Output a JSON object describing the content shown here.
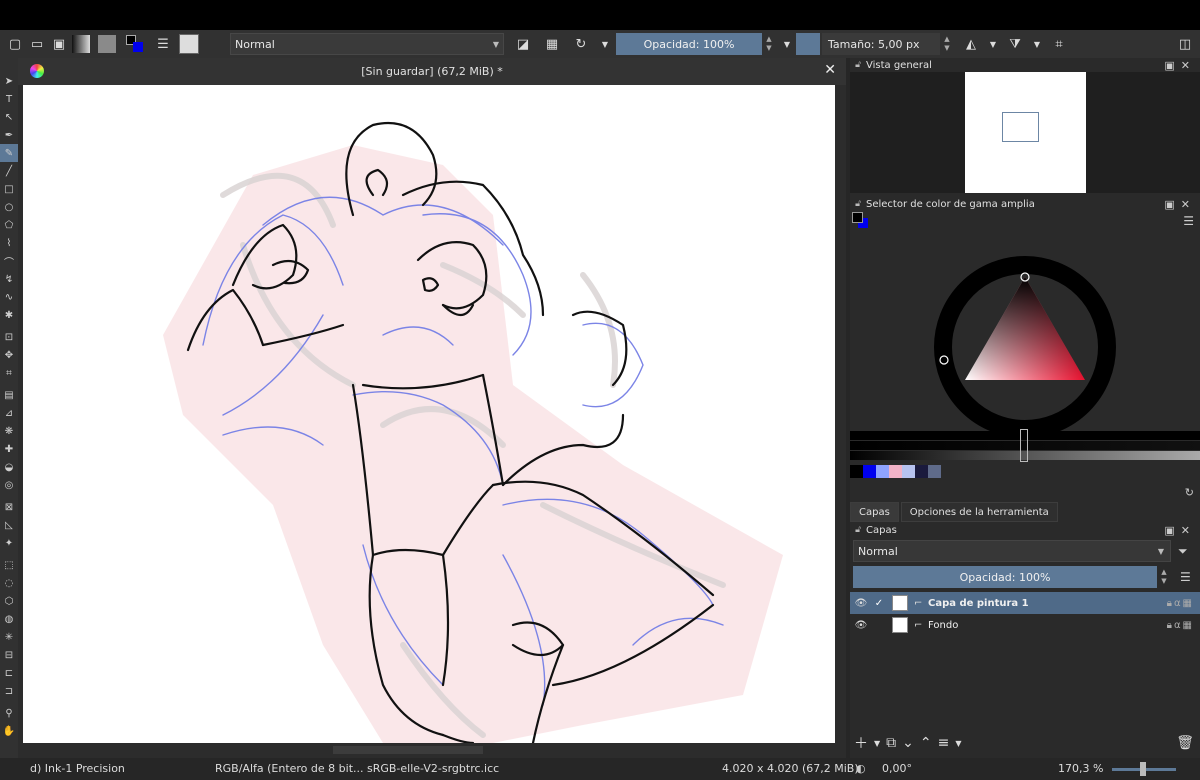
{
  "toolbar": {
    "blend_mode": "Normal",
    "opacity": "Opacidad: 100%",
    "size": "Tamaño: 5,00 px",
    "icons": [
      "new-doc-icon",
      "open-folder-icon",
      "save-icon",
      "gradient-icon",
      "pattern-icon",
      "color-swap-icon",
      "preset-list-icon",
      "brush-preset-icon",
      "eraser-icon",
      "alpha-lock-icon",
      "reload-icon",
      "mirror-horizontal-icon",
      "mirror-vertical-icon",
      "wrap-icon",
      "dock-toggle-icon"
    ]
  },
  "document": {
    "title": "[Sin guardar]  (67,2 MiB) *",
    "close": "✕"
  },
  "overview_panel": {
    "title": "Vista general"
  },
  "color_panel": {
    "title": "Selector de color de gama amplia",
    "foreground": "#000000",
    "background": "#0000ee",
    "hue_color": "#e8102e",
    "recent_swatches": [
      "#000000",
      "#0000ee",
      "#8fa3ff",
      "#f2b3c8",
      "#b7c3f0",
      "#1a1a3d",
      "#5f6b8a"
    ]
  },
  "layers_tabs": {
    "tab1": "Capas",
    "tab2": "Opciones de la herramienta"
  },
  "layers_panel": {
    "title": "Capas",
    "blend_mode": "Normal",
    "opacity": "Opacidad:  100%",
    "layers": [
      {
        "name": "Capa de pintura 1",
        "selected": true
      },
      {
        "name": "Fondo",
        "selected": false
      }
    ]
  },
  "status": {
    "brush": "d) Ink-1 Precision",
    "color_space": "RGB/Alfa (Entero de 8 bit... sRGB-elle-V2-srgbtrc.icc",
    "image_size": "4.020 x 4.020 (67,2 MiB)",
    "rotation": "0,00°",
    "zoom": "170,3 %"
  },
  "colors": {
    "accent": "#5d7997",
    "panel": "#2a2a2a",
    "toolbar": "#313131"
  }
}
